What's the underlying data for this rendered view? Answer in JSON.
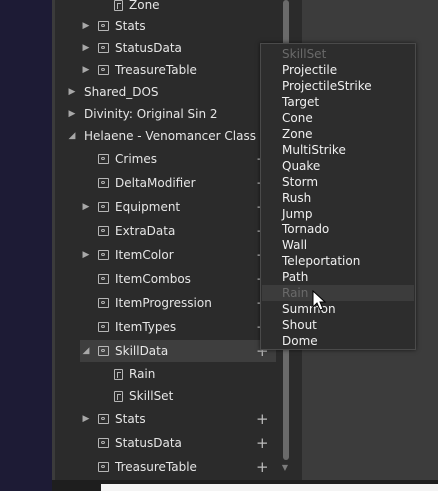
{
  "tree": {
    "items": [
      {
        "label": "Zone",
        "icon": "file-icon",
        "expander": "none"
      },
      {
        "label": "Stats",
        "icon": "folder-icon",
        "expander": "collapsed"
      },
      {
        "label": "StatusData",
        "icon": "folder-icon",
        "expander": "collapsed"
      },
      {
        "label": "TreasureTable",
        "icon": "folder-icon",
        "expander": "collapsed"
      },
      {
        "label": "Shared_DOS",
        "icon": "",
        "expander": "collapsed"
      },
      {
        "label": "Divinity: Original Sin 2",
        "icon": "",
        "expander": "collapsed"
      },
      {
        "label": "Helaene - Venomancer Class (DE)",
        "icon": "",
        "expander": "expanded"
      },
      {
        "label": "Crimes",
        "icon": "folder-icon",
        "expander": "none"
      },
      {
        "label": "DeltaModifier",
        "icon": "folder-icon",
        "expander": "none"
      },
      {
        "label": "Equipment",
        "icon": "folder-icon",
        "expander": "collapsed"
      },
      {
        "label": "ExtraData",
        "icon": "folder-icon",
        "expander": "none"
      },
      {
        "label": "ItemColor",
        "icon": "folder-icon",
        "expander": "collapsed"
      },
      {
        "label": "ItemCombos",
        "icon": "folder-icon",
        "expander": "none"
      },
      {
        "label": "ItemProgression",
        "icon": "folder-icon",
        "expander": "none"
      },
      {
        "label": "ItemTypes",
        "icon": "folder-icon",
        "expander": "none"
      },
      {
        "label": "SkillData",
        "icon": "folder-icon",
        "expander": "expanded"
      },
      {
        "label": "Rain",
        "icon": "file-icon",
        "expander": "none"
      },
      {
        "label": "SkillSet",
        "icon": "file-icon",
        "expander": "none"
      },
      {
        "label": "Stats",
        "icon": "folder-icon",
        "expander": "collapsed"
      },
      {
        "label": "StatusData",
        "icon": "folder-icon",
        "expander": "none"
      },
      {
        "label": "TreasureTable",
        "icon": "folder-icon",
        "expander": "none"
      }
    ],
    "add_symbol": "+",
    "expander_collapsed": "▶",
    "expander_expanded": "◢"
  },
  "dropdown": {
    "items": [
      {
        "label": "SkillSet",
        "disabled": true
      },
      {
        "label": "Projectile",
        "disabled": false
      },
      {
        "label": "ProjectileStrike",
        "disabled": false
      },
      {
        "label": "Target",
        "disabled": false
      },
      {
        "label": "Cone",
        "disabled": false
      },
      {
        "label": "Zone",
        "disabled": false
      },
      {
        "label": "MultiStrike",
        "disabled": false
      },
      {
        "label": "Quake",
        "disabled": false
      },
      {
        "label": "Storm",
        "disabled": false
      },
      {
        "label": "Rush",
        "disabled": false
      },
      {
        "label": "Jump",
        "disabled": false
      },
      {
        "label": "Tornado",
        "disabled": false
      },
      {
        "label": "Wall",
        "disabled": false
      },
      {
        "label": "Teleportation",
        "disabled": false
      },
      {
        "label": "Path",
        "disabled": false
      },
      {
        "label": "Rain",
        "disabled": true
      },
      {
        "label": "Summon",
        "disabled": false
      },
      {
        "label": "Shout",
        "disabled": false
      },
      {
        "label": "Dome",
        "disabled": false
      }
    ],
    "hovered": "Summon"
  },
  "colors": {
    "text": "#e6e6e6",
    "disabled": "#6a6a6a",
    "panel": "#2b2b2b",
    "menu": "#2d2d2d"
  }
}
